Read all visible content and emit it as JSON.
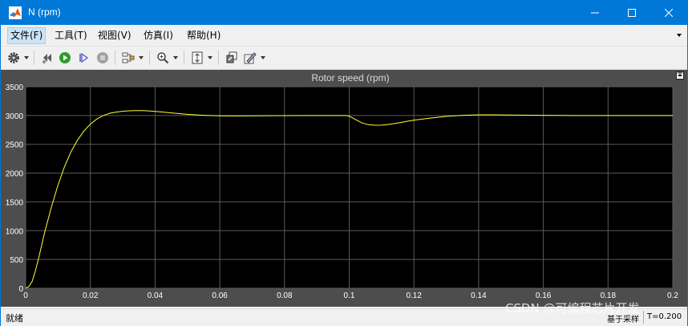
{
  "window": {
    "title": "N (rpm)",
    "controls": [
      "minimize-icon",
      "maximize-icon",
      "close-icon"
    ]
  },
  "menu": {
    "items": [
      {
        "label": "文件(F)"
      },
      {
        "label": "工具(T)"
      },
      {
        "label": "视图(V)"
      },
      {
        "label": "仿真(I)"
      },
      {
        "label": "帮助(H)"
      }
    ]
  },
  "toolbar": {
    "icons": [
      "gear-icon",
      "step-back-icon",
      "run-icon",
      "step-forward-icon",
      "stop-icon",
      "highlight-icon",
      "zoom-in-icon",
      "autoscale-icon",
      "restore-view-icon",
      "style-icon"
    ]
  },
  "colors": {
    "titlebar": "#0078d7",
    "plot_background": "#000000",
    "figure_background": "#4d4d4d",
    "grid": "#5a5a5a",
    "signal": "#ffff33",
    "axis_text": "#ffffff"
  },
  "chart_data": {
    "type": "line",
    "title": "Rotor speed (rpm)",
    "xlabel": "",
    "ylabel": "",
    "xlim": [
      0,
      0.2
    ],
    "ylim": [
      0,
      3500
    ],
    "xticks": [
      "0",
      "0.02",
      "0.04",
      "0.06",
      "0.08",
      "0.1",
      "0.12",
      "0.14",
      "0.16",
      "0.18",
      "0.2"
    ],
    "yticks": [
      "0",
      "500",
      "1000",
      "1500",
      "2000",
      "2500",
      "3000",
      "3500"
    ],
    "grid": true,
    "series": [
      {
        "x": [
          0,
          0.001,
          0.002,
          0.003,
          0.004,
          0.005,
          0.006,
          0.008,
          0.01,
          0.012,
          0.014,
          0.016,
          0.018,
          0.02,
          0.022,
          0.024,
          0.026,
          0.028,
          0.03,
          0.032,
          0.034,
          0.036,
          0.038,
          0.04,
          0.042,
          0.045,
          0.05,
          0.055,
          0.06,
          0.065,
          0.07,
          0.08,
          0.09,
          0.099,
          0.1,
          0.102,
          0.104,
          0.106,
          0.108,
          0.11,
          0.112,
          0.115,
          0.118,
          0.12,
          0.125,
          0.13,
          0.135,
          0.14,
          0.145,
          0.15,
          0.16,
          0.17,
          0.18,
          0.19,
          0.2
        ],
        "y": [
          0,
          30,
          120,
          300,
          520,
          760,
          1000,
          1420,
          1790,
          2110,
          2370,
          2570,
          2730,
          2850,
          2940,
          3000,
          3040,
          3060,
          3075,
          3082,
          3085,
          3085,
          3080,
          3072,
          3062,
          3045,
          3020,
          3003,
          2995,
          2993,
          2995,
          2998,
          3000,
          3000,
          2990,
          2930,
          2870,
          2840,
          2830,
          2832,
          2845,
          2870,
          2900,
          2920,
          2955,
          2985,
          3003,
          3012,
          3012,
          3008,
          3003,
          3000,
          3000,
          3000,
          3000
        ]
      }
    ]
  },
  "status": {
    "left": "就绪",
    "sample": "基于采样",
    "time": "T=0.200"
  },
  "watermark": "CSDN @可编程芯片开发"
}
